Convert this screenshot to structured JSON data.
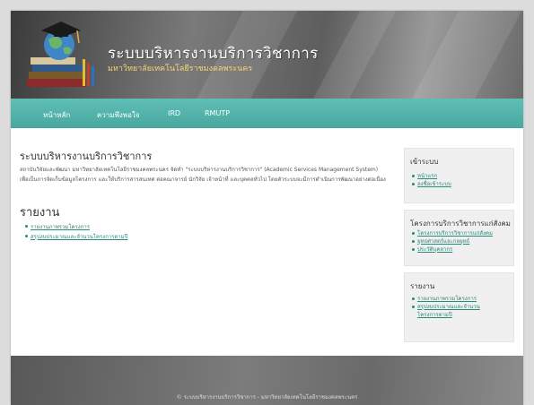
{
  "header": {
    "title": "ระบบบริหารงานบริการวิชาการ",
    "subtitle": "มหาวิทยาลัยเทคโนโลยีราชมงคลพระนคร"
  },
  "nav": {
    "items": [
      {
        "label": "หน้าหลัก"
      },
      {
        "label": "ความพึงพอใจ"
      },
      {
        "label": "IRD"
      },
      {
        "label": "RMUTP"
      }
    ]
  },
  "main": {
    "title": "ระบบบริหารงานบริการวิชาการ",
    "description": "สถาบันวิจัยและพัฒนา มหาวิทยาลัยเทคโนโลยีราชมงคลพระนคร จัดทำ \"ระบบบริหารงานบริการวิชาการ\" (Academic Services Management System) เพื่อเป็นการจัดเก็บข้อมูลโครงการ และให้บริการสารสนเทศ ต่อคณาจารย์ นักวิจัย เจ้าหน้าที่ และบุคคลทั่วไป โดยตัวระบบจะมีการดำเนินการพัฒนาอย่างต่อเนื่อง",
    "report_heading": "รายงาน",
    "report_links": [
      {
        "label": "รายงานภาพรวมโครงการ"
      },
      {
        "label": "สรุปงบประมาณและจำนวนโครงการตามปี"
      }
    ]
  },
  "sidebar": {
    "login": {
      "title": "เข้าระบบ",
      "links": [
        {
          "label": "หน้าแรก"
        },
        {
          "label": "ลงชื่อเข้าระบบ"
        }
      ]
    },
    "projects": {
      "title": "โครงการบริการวิชาการแก่สังคม",
      "links": [
        {
          "label": "โครงการบริการวิชาการแก่สังคม"
        },
        {
          "label": "ยุทธศาสตร์และกลยุทธ์"
        },
        {
          "label": "ประวัติบุคลากร"
        }
      ]
    },
    "reports": {
      "title": "รายงาน",
      "links": [
        {
          "label": "รายงานภาพรวมโครงการ"
        },
        {
          "label": "สรุปงบประมาณและจำนวน"
        },
        {
          "label": "โครงการตามปี"
        }
      ]
    }
  },
  "footer": {
    "text": "© ระบบบริหารงานบริการวิชาการ - มหาวิทยาลัยเทคโนโลยีราชมงคลพระนคร"
  },
  "colors": {
    "nav_bg": "#52b3ab",
    "link": "#2a8a7a",
    "subtitle": "#f5d478"
  }
}
